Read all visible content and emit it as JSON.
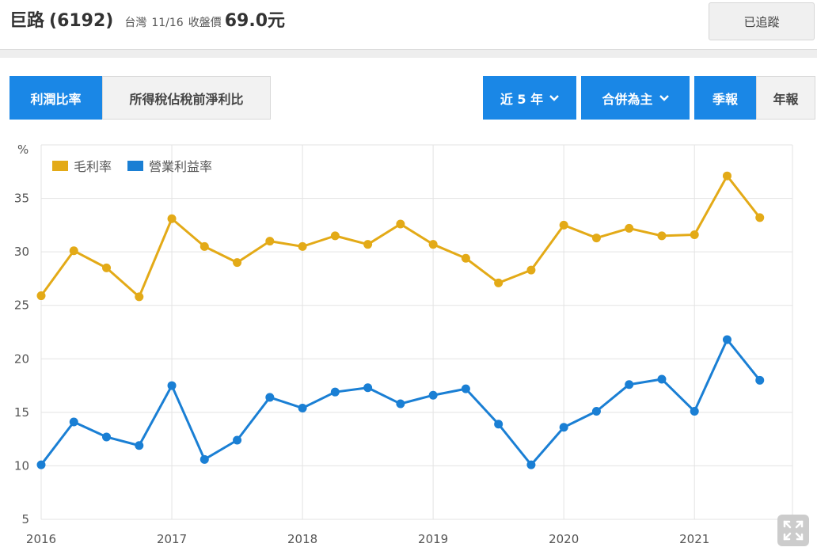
{
  "header": {
    "stock_name": "巨路",
    "stock_code": "(6192)",
    "market": "台灣",
    "date": "11/16",
    "price_label": "收盤價",
    "price": "69.0元",
    "follow_label": "已追蹤"
  },
  "controls": {
    "tab_margin": "利潤比率",
    "tab_tax": "所得稅佔稅前淨利比",
    "range": "近 5 年",
    "consolidation": "合併為主",
    "quarterly": "季報",
    "annual": "年報"
  },
  "colors": {
    "accent": "#1a87e6",
    "gross_margin": "#e3aa17",
    "operating_margin": "#1a7fd4"
  },
  "icons": {
    "chevron": "chevron-down-icon",
    "expand": "expand-icon"
  },
  "chart_data": {
    "type": "line",
    "ylabel": "%",
    "ylim": [
      5,
      40
    ],
    "yticks": [
      5,
      10,
      15,
      20,
      25,
      30,
      35
    ],
    "xlim": [
      2016,
      2021.75
    ],
    "xticks": [
      2016,
      2017,
      2018,
      2019,
      2020,
      2021
    ],
    "xticklabels": [
      "2016",
      "2017",
      "2018",
      "2019",
      "2020",
      "2021"
    ],
    "grid": true,
    "legend": "top-left",
    "x": [
      2016.0,
      2016.25,
      2016.5,
      2016.75,
      2017.0,
      2017.25,
      2017.5,
      2017.75,
      2018.0,
      2018.25,
      2018.5,
      2018.75,
      2019.0,
      2019.25,
      2019.5,
      2019.75,
      2020.0,
      2020.25,
      2020.5,
      2020.75,
      2021.0,
      2021.25,
      2021.5
    ],
    "series": [
      {
        "name": "毛利率",
        "color": "#e3aa17",
        "values": [
          25.9,
          30.1,
          28.5,
          25.8,
          33.1,
          30.5,
          29.0,
          31.0,
          30.5,
          31.5,
          30.7,
          32.6,
          30.7,
          29.4,
          27.1,
          28.3,
          32.5,
          31.3,
          32.2,
          31.5,
          31.6,
          37.1,
          33.2
        ]
      },
      {
        "name": "營業利益率",
        "color": "#1a7fd4",
        "values": [
          10.1,
          14.1,
          12.7,
          11.9,
          17.5,
          10.6,
          12.4,
          16.4,
          15.4,
          16.9,
          17.3,
          15.8,
          16.6,
          17.2,
          13.9,
          10.1,
          13.6,
          15.1,
          17.6,
          18.1,
          15.1,
          21.8,
          18.0
        ]
      }
    ]
  }
}
